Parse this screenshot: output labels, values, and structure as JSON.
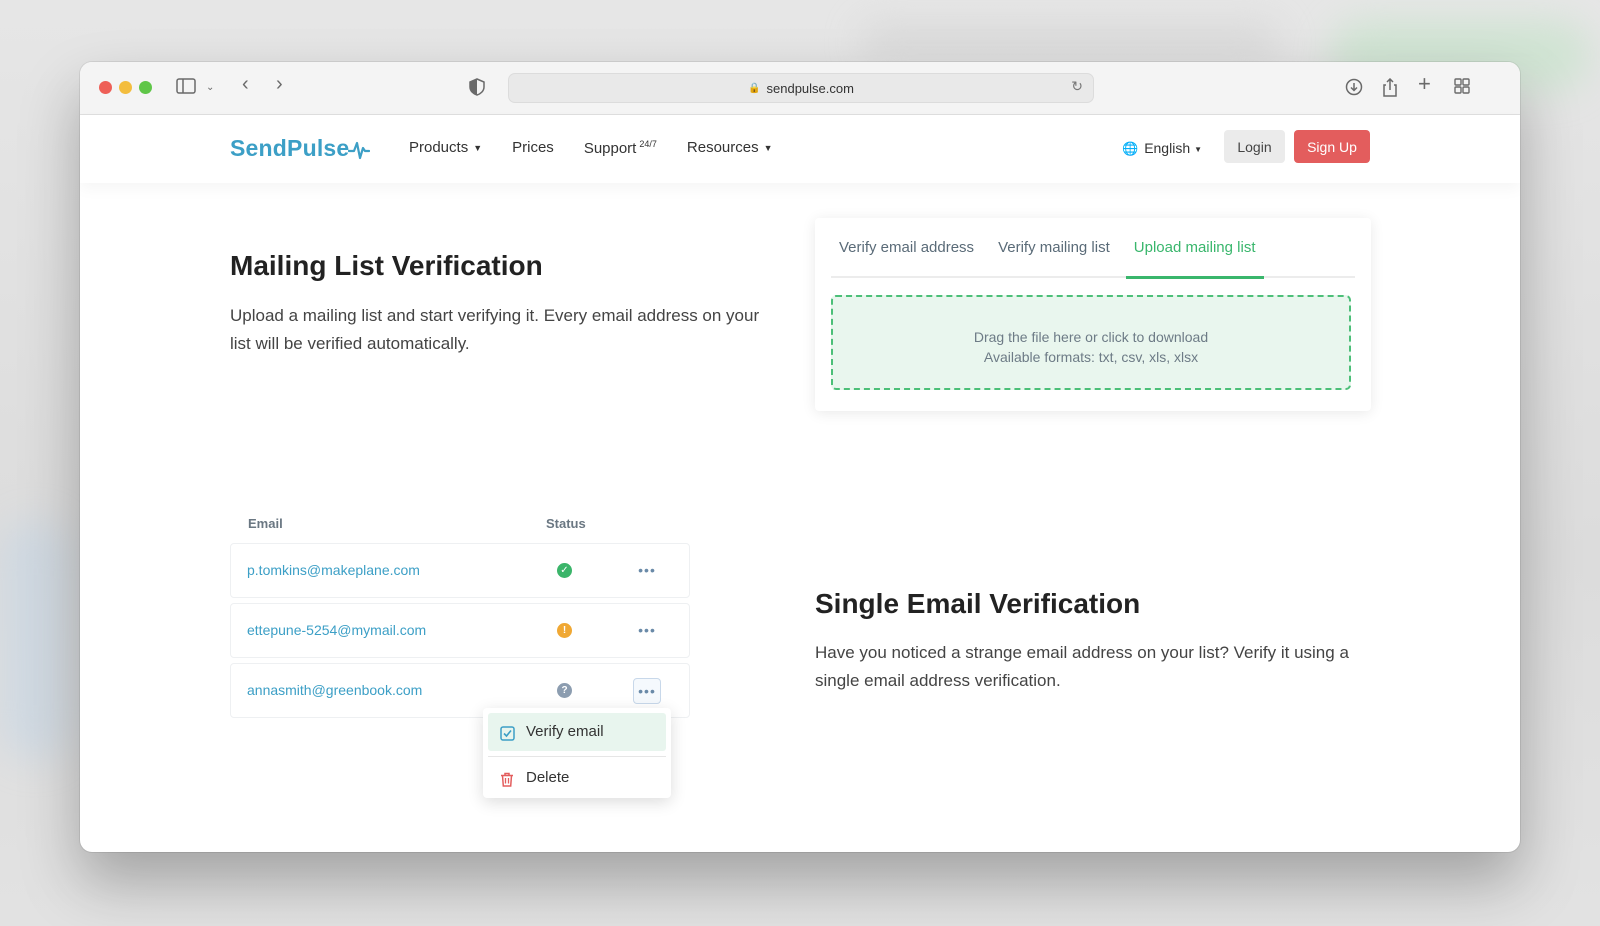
{
  "browser": {
    "url": "sendpulse.com"
  },
  "header": {
    "logo": "SendPulse",
    "nav": [
      {
        "label": "Products",
        "has_caret": true
      },
      {
        "label": "Prices"
      },
      {
        "label": "Support",
        "sup": "24/7"
      },
      {
        "label": "Resources",
        "has_caret": true
      }
    ],
    "language": "English",
    "login": "Login",
    "signup": "Sign Up",
    "signup_color": "#e35d5d"
  },
  "mailing": {
    "title": "Mailing List Verification",
    "description": "Upload a mailing list and start verifying it. Every email address on your list will be verified automatically."
  },
  "upload_card": {
    "tabs": [
      {
        "label": "Verify email address"
      },
      {
        "label": "Verify mailing list"
      },
      {
        "label": "Upload mailing list",
        "active": true
      }
    ],
    "dropzone_line1": "Drag the file here or click to download",
    "dropzone_line2": "Available formats: txt, csv, xls, xlsx",
    "accent": "#39b66c"
  },
  "table": {
    "headers": {
      "email": "Email",
      "status": "Status"
    },
    "rows": [
      {
        "email": "p.tomkins@makeplane.com",
        "status": "valid",
        "status_color": "#3bb56a",
        "status_icon": "check-icon"
      },
      {
        "email": "ettepune-5254@mymail.com",
        "status": "warning",
        "status_color": "#f0a834",
        "status_icon": "exclamation-icon"
      },
      {
        "email": "annasmith@greenbook.com",
        "status": "unknown",
        "status_color": "#8c9db0",
        "status_icon": "question-icon"
      }
    ],
    "actions_glyph": "•••"
  },
  "row_menu": {
    "items": [
      {
        "label": "Verify email",
        "icon": "checkbox-icon",
        "highlighted": true
      },
      {
        "label": "Delete",
        "icon": "trash-icon"
      }
    ]
  },
  "single": {
    "title": "Single Email Verification",
    "description": "Have you noticed a strange email address on your list? Verify it using a single email address verification."
  }
}
